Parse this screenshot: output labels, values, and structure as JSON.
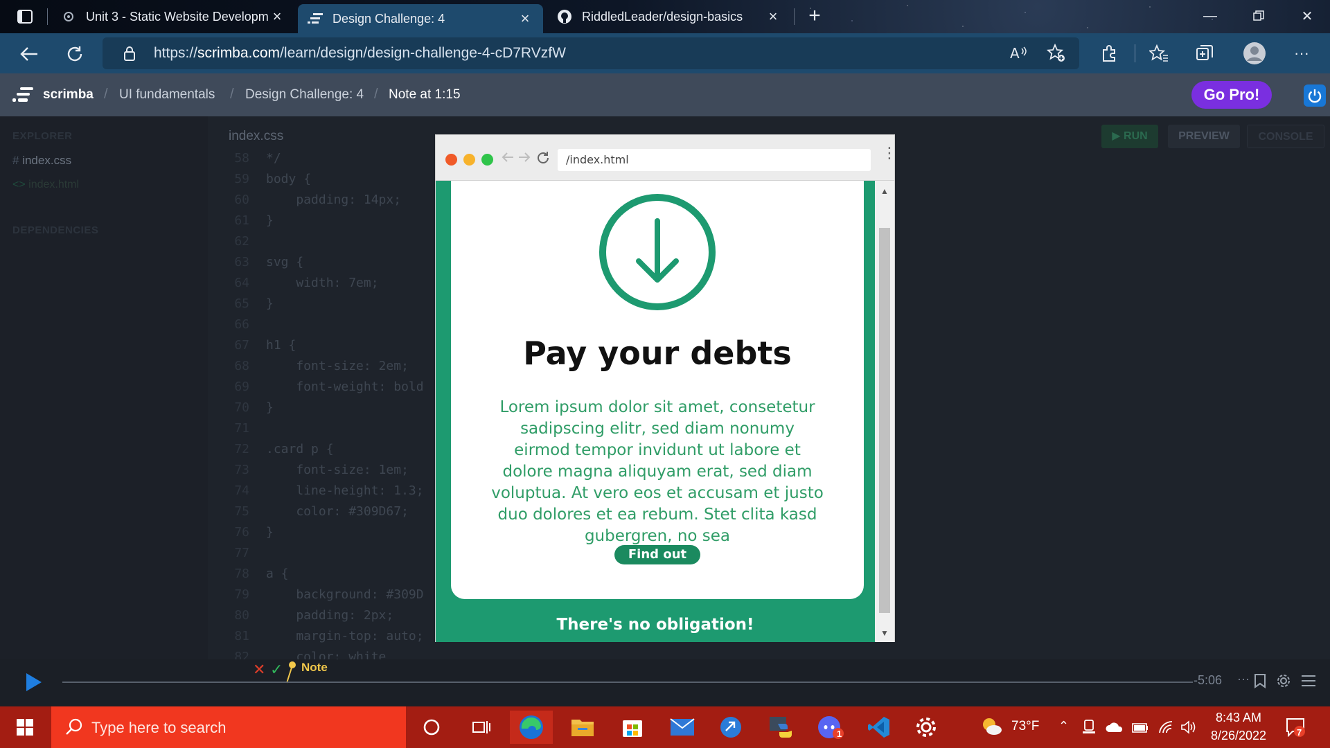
{
  "browser": {
    "tabs": [
      {
        "title": "Unit 3 - Static Website Developm",
        "active": false
      },
      {
        "title": "Design Challenge: 4",
        "active": true
      },
      {
        "title": "RiddledLeader/design-basics",
        "active": false
      }
    ],
    "url_prefix": "https://",
    "url_host": "scrimba.com",
    "url_path": "/learn/design/design-challenge-4-cD7RVzfW"
  },
  "scrimba": {
    "brand": "scrimba",
    "breadcrumbs": [
      "UI fundamentals",
      "Design Challenge: 4",
      "Note at 1:15"
    ],
    "go_pro": "Go Pro!"
  },
  "editor": {
    "explorer_label": "EXPLORER",
    "files": [
      "index.css",
      "index.html"
    ],
    "dependencies_label": "DEPENDENCIES",
    "active_tab": "index.css",
    "buttons": {
      "run": "RUN",
      "preview": "PREVIEW",
      "console": "CONSOLE"
    },
    "lines": [
      {
        "n": "58",
        "code": "*/"
      },
      {
        "n": "59",
        "code": "body {"
      },
      {
        "n": "60",
        "code": "    padding: 14px;"
      },
      {
        "n": "61",
        "code": "}"
      },
      {
        "n": "62",
        "code": ""
      },
      {
        "n": "63",
        "code": "svg {"
      },
      {
        "n": "64",
        "code": "    width: 7em;"
      },
      {
        "n": "65",
        "code": "}"
      },
      {
        "n": "66",
        "code": ""
      },
      {
        "n": "67",
        "code": "h1 {"
      },
      {
        "n": "68",
        "code": "    font-size: 2em;"
      },
      {
        "n": "69",
        "code": "    font-weight: bold"
      },
      {
        "n": "70",
        "code": "}"
      },
      {
        "n": "71",
        "code": ""
      },
      {
        "n": "72",
        "code": ".card p {"
      },
      {
        "n": "73",
        "code": "    font-size: 1em;"
      },
      {
        "n": "74",
        "code": "    line-height: 1.3;"
      },
      {
        "n": "75",
        "code": "    color: #309D67;"
      },
      {
        "n": "76",
        "code": "}"
      },
      {
        "n": "77",
        "code": ""
      },
      {
        "n": "78",
        "code": "a {"
      },
      {
        "n": "79",
        "code": "    background: #309D"
      },
      {
        "n": "80",
        "code": "    padding: 2px;"
      },
      {
        "n": "81",
        "code": "    margin-top: auto;"
      },
      {
        "n": "82",
        "code": "    color: white"
      }
    ]
  },
  "preview": {
    "url": "/index.html",
    "heading": "Pay your debts",
    "body": "Lorem ipsum dolor sit amet, consetetur sadipscing elitr, sed diam nonumy eirmod tempor invidunt ut labore et dolore magna aliquyam erat, sed diam voluptua. At vero eos et accusam et justo duo dolores et ea rebum. Stet clita kasd gubergren, no sea",
    "cta": "Find out how",
    "footer": "There's no obligation!",
    "accent": "#1d9a70"
  },
  "player": {
    "note_label": "Note",
    "time_remaining": "-5:06",
    "more": "···"
  },
  "taskbar": {
    "search_placeholder": "Type here to search",
    "weather": "73°F",
    "time": "8:43 AM",
    "date": "8/26/2022",
    "notification_count": "7",
    "discord_badge": "1"
  }
}
